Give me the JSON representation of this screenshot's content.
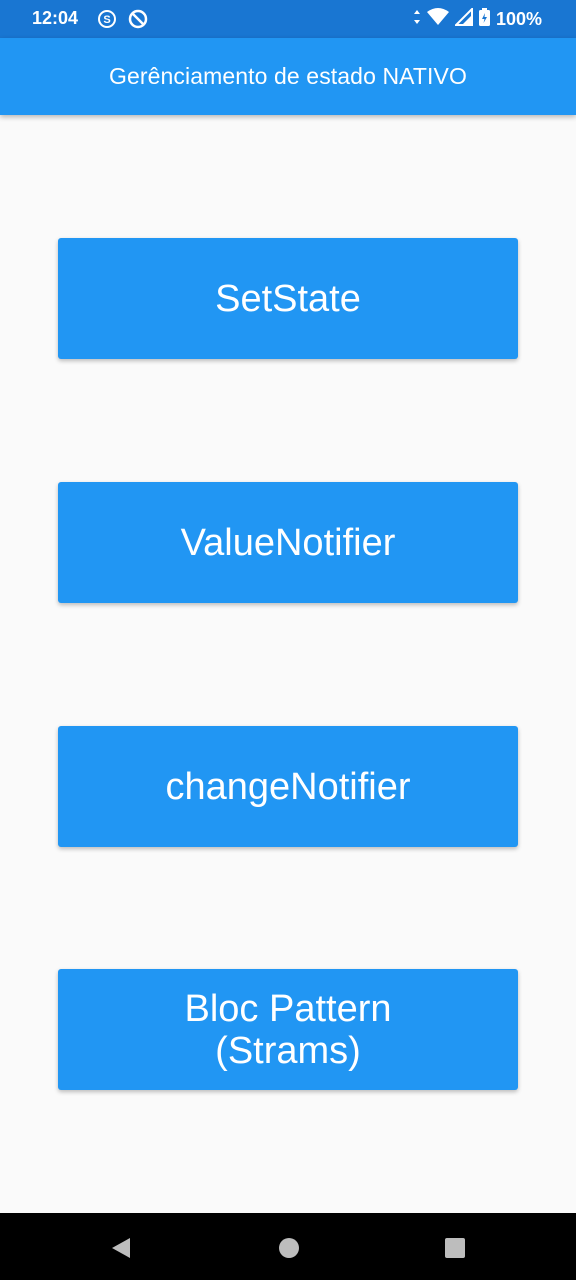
{
  "status_bar": {
    "time": "12:04",
    "battery": "100%",
    "icons": [
      "s-circle-icon",
      "blocked-circle-icon",
      "data-arrows-icon",
      "wifi-icon",
      "signal-icon",
      "battery-charging-icon"
    ]
  },
  "app_bar": {
    "title": "Gerênciamento de estado NATIVO"
  },
  "buttons": [
    {
      "label": "SetState"
    },
    {
      "label": "ValueNotifier"
    },
    {
      "label": "changeNotifier"
    },
    {
      "label": "Bloc Pattern (Strams)"
    }
  ],
  "nav_bar": {
    "icons": [
      "back-icon",
      "home-icon",
      "recents-icon"
    ]
  },
  "colors": {
    "primary": "#2196f3",
    "status_bar": "#1976d2",
    "background": "#fafafa",
    "nav_bar": "#000000"
  }
}
